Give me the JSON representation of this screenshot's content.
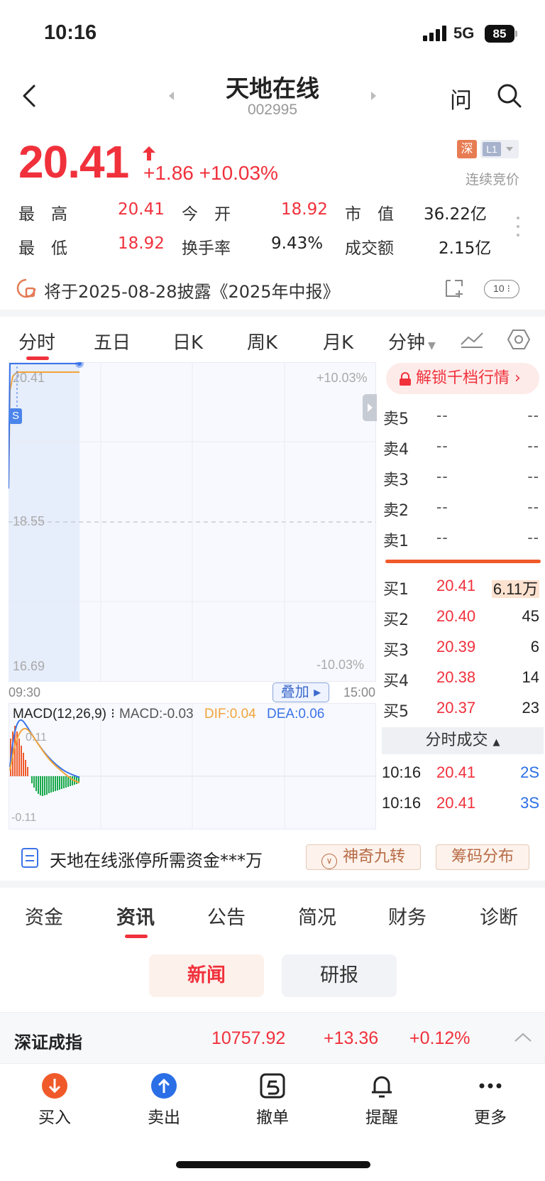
{
  "status_bar": {
    "time": "10:16",
    "network": "5G",
    "battery": "85"
  },
  "header": {
    "name": "天地在线",
    "code": "002995",
    "ask_label": "问"
  },
  "quote": {
    "price": "20.41",
    "change": "+1.86",
    "change_pct": "+10.03%",
    "market_tag": "深",
    "level_tag": "L1",
    "auction_status": "连续竞价",
    "high_label": "最　高",
    "high": "20.41",
    "low_label": "最　低",
    "low": "18.92",
    "open_label": "今　开",
    "open": "18.92",
    "turnover_label": "换手率",
    "turnover": "9.43%",
    "mktcap_label": "市　值",
    "mktcap": "36.22亿",
    "amount_label": "成交额",
    "amount": "2.15亿"
  },
  "disclosure": {
    "text": "将于2025-08-28披露《2025年中报》",
    "badge": "10"
  },
  "chart_tabs": [
    "分时",
    "五日",
    "日K",
    "周K",
    "月K",
    "分钟"
  ],
  "chart": {
    "price_top": "20.41",
    "pct_top": "+10.03%",
    "price_mid": "18.55",
    "price_bottom": "16.69",
    "pct_bottom": "-10.03%",
    "time_start": "09:30",
    "time_end": "15:00",
    "overlay_label": "叠加",
    "s_marker": "S",
    "macd_title": "MACD(12,26,9)",
    "macd_value": "MACD:-0.03",
    "dif_value": "DIF:0.04",
    "dea_value": "DEA:0.06",
    "macd_top_tick": "0.11",
    "macd_bottom_tick": "-0.11"
  },
  "order_book": {
    "unlock_label": "解锁千档行情",
    "asks": [
      {
        "label": "卖5",
        "price": "--",
        "vol": "--"
      },
      {
        "label": "卖4",
        "price": "--",
        "vol": "--"
      },
      {
        "label": "卖3",
        "price": "--",
        "vol": "--"
      },
      {
        "label": "卖2",
        "price": "--",
        "vol": "--"
      },
      {
        "label": "卖1",
        "price": "--",
        "vol": "--"
      }
    ],
    "bids": [
      {
        "label": "买1",
        "price": "20.41",
        "vol": "6.11万"
      },
      {
        "label": "买2",
        "price": "20.40",
        "vol": "45"
      },
      {
        "label": "买3",
        "price": "20.39",
        "vol": "6"
      },
      {
        "label": "买4",
        "price": "20.38",
        "vol": "14"
      },
      {
        "label": "买5",
        "price": "20.37",
        "vol": "23"
      }
    ],
    "trades_header": "分时成交",
    "trades": [
      {
        "time": "10:16",
        "price": "20.41",
        "vol": "2S"
      },
      {
        "time": "10:16",
        "price": "20.41",
        "vol": "3S"
      }
    ]
  },
  "limit_bar": {
    "text": "天地在线涨停所需资金***万",
    "nine_turn": "神奇九转",
    "chips": "筹码分布"
  },
  "bottom_tabs": [
    "资金",
    "资讯",
    "公告",
    "简况",
    "财务",
    "诊断"
  ],
  "segments": {
    "news": "新闻",
    "report": "研报"
  },
  "index_bar": {
    "name": "深证成指",
    "value": "10757.92",
    "change": "+13.36",
    "pct": "+0.12%"
  },
  "actions": [
    {
      "label": "买入",
      "icon": "buy-icon"
    },
    {
      "label": "卖出",
      "icon": "sell-icon"
    },
    {
      "label": "撤单",
      "icon": "cancel-order-icon"
    },
    {
      "label": "提醒",
      "icon": "bell-icon"
    },
    {
      "label": "更多",
      "icon": "more-icon"
    }
  ],
  "colors": {
    "up": "#f0313c",
    "down": "#17a84a",
    "accent_blue": "#2b6fe6",
    "dif": "#f2a43a",
    "dea": "#3b74e8"
  }
}
